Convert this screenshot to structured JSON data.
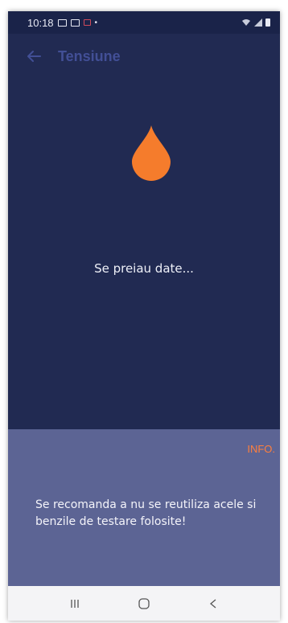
{
  "status_bar": {
    "time": "10:18",
    "icons": [
      "image-icon",
      "gallery-icon",
      "mail-icon",
      "dot-icon",
      "wifi-icon",
      "signal-icon",
      "battery-icon"
    ],
    "dot": "•"
  },
  "app_bar": {
    "back_icon": "arrow-left-icon",
    "title": "Tensiune"
  },
  "main": {
    "drop_icon": "blood-drop-icon",
    "drop_color": "#f57c2c",
    "loading_text": "Se preiau date..."
  },
  "info_panel": {
    "link_label": "INFO.",
    "message": "Se recomanda a nu se reutiliza acele si benzile de testare folosite!"
  },
  "nav_bar": {
    "recents_icon": "recents-icon",
    "home_icon": "home-icon",
    "back_icon": "back-chevron-icon"
  },
  "colors": {
    "background": "#212a52",
    "title": "#424f96",
    "info_panel": "#5c6494",
    "accent": "#ff7f3d"
  }
}
